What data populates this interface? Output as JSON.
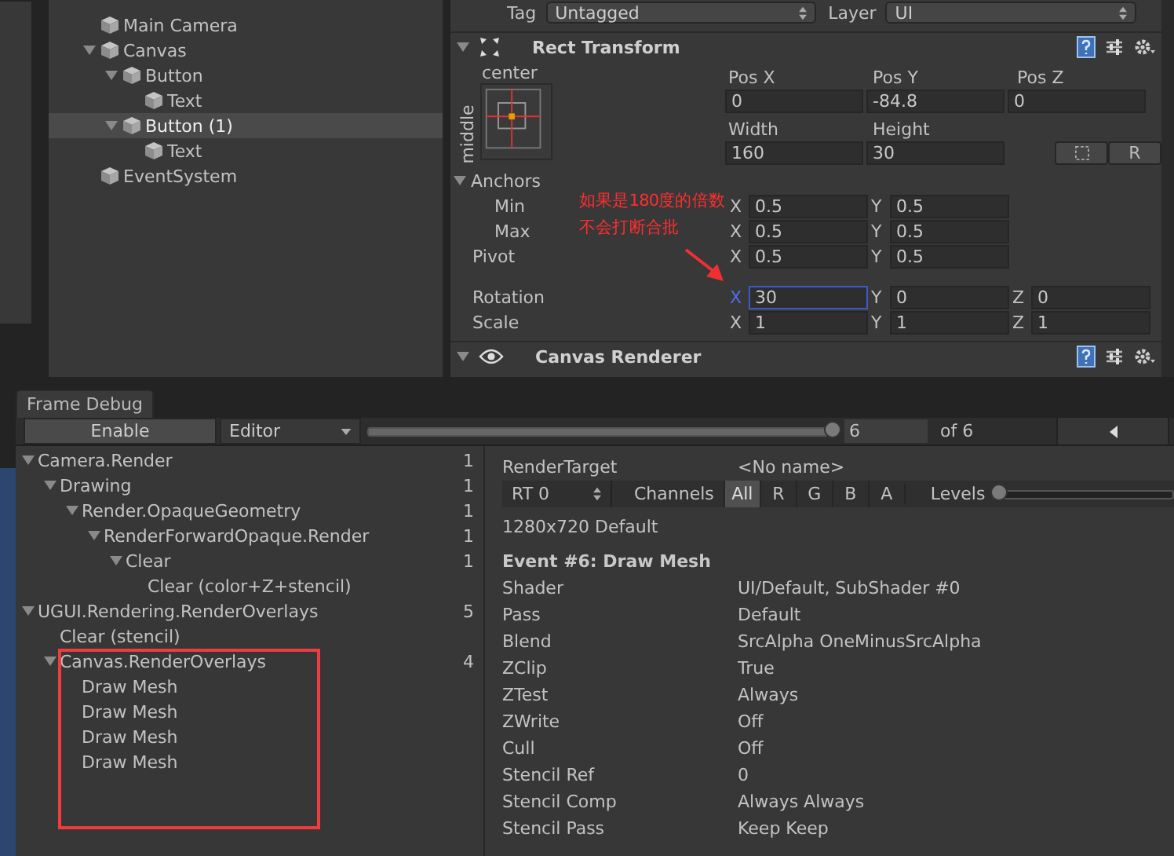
{
  "hierarchy": {
    "items": [
      {
        "label": "Main Camera",
        "selected": false
      },
      {
        "label": "Canvas",
        "selected": false,
        "children": [
          {
            "label": "Button",
            "selected": false,
            "children": [
              {
                "label": "Text",
                "selected": false
              }
            ]
          },
          {
            "label": "Button (1)",
            "selected": true,
            "children": [
              {
                "label": "Text",
                "selected": false
              }
            ]
          }
        ]
      },
      {
        "label": "EventSystem",
        "selected": false
      }
    ]
  },
  "inspector": {
    "tag": {
      "label": "Tag",
      "value": "Untagged"
    },
    "layer": {
      "label": "Layer",
      "value": "UI"
    },
    "rect_transform": {
      "title": "Rect Transform",
      "anchor_horizontal": "center",
      "anchor_vertical": "middle",
      "fields": [
        {
          "label": "Pos X",
          "value": "0"
        },
        {
          "label": "Pos Y",
          "value": "-84.8"
        },
        {
          "label": "Pos Z",
          "value": "0"
        },
        {
          "label": "Width",
          "value": "160"
        },
        {
          "label": "Height",
          "value": "30"
        }
      ],
      "raw_button": "R",
      "rows": [
        {
          "label": "Anchors",
          "children": [
            {
              "label": "Min",
              "values": [
                {
                  "axis": "X",
                  "value": "0.5",
                  "focused": false
                },
                {
                  "axis": "Y",
                  "value": "0.5",
                  "focused": false
                }
              ]
            },
            {
              "label": "Max",
              "values": [
                {
                  "axis": "X",
                  "value": "0.5",
                  "focused": false
                },
                {
                  "axis": "Y",
                  "value": "0.5",
                  "focused": false
                }
              ]
            }
          ]
        },
        {
          "label": "Pivot",
          "values": [
            {
              "axis": "X",
              "value": "0.5",
              "focused": false
            },
            {
              "axis": "Y",
              "value": "0.5",
              "focused": false
            }
          ]
        },
        {
          "label": "Rotation",
          "values": [
            {
              "axis": "X",
              "value": "30",
              "focused": true
            },
            {
              "axis": "Y",
              "value": "0",
              "focused": false
            },
            {
              "axis": "Z",
              "value": "0",
              "focused": false
            }
          ]
        },
        {
          "label": "Scale",
          "values": [
            {
              "axis": "X",
              "value": "1",
              "focused": false
            },
            {
              "axis": "Y",
              "value": "1",
              "focused": false
            },
            {
              "axis": "Z",
              "value": "1",
              "focused": false
            }
          ]
        }
      ]
    },
    "canvas_renderer": {
      "title": "Canvas Renderer"
    }
  },
  "annotation": {
    "lines": [
      "如果是180度的倍数",
      "不会打断合批"
    ]
  },
  "frame_debug": {
    "tab": "Frame Debug",
    "enable_button": "Enable",
    "target": "Editor",
    "event_slider": {
      "level": 1
    },
    "event_number": "6",
    "event_total": "of 6",
    "events": [
      {
        "label": "Camera.Render",
        "count": "1",
        "children": [
          {
            "label": "Drawing",
            "count": "1",
            "children": [
              {
                "label": "Render.OpaqueGeometry",
                "count": "1",
                "children": [
                  {
                    "label": "RenderForwardOpaque.Render",
                    "count": "1",
                    "children": [
                      {
                        "label": "Clear",
                        "count": "1",
                        "children": [
                          {
                            "label": "Clear (color+Z+stencil)"
                          }
                        ]
                      }
                    ]
                  }
                ]
              }
            ]
          }
        ]
      },
      {
        "label": "UGUI.Rendering.RenderOverlays",
        "count": "5",
        "children": [
          {
            "label": "Clear (stencil)"
          },
          {
            "label": "Canvas.RenderOverlays",
            "count": "4",
            "children": [
              {
                "label": "Draw Mesh"
              },
              {
                "label": "Draw Mesh"
              },
              {
                "label": "Draw Mesh"
              },
              {
                "label": "Draw Mesh"
              }
            ]
          }
        ]
      }
    ],
    "render_target": {
      "label": "RenderTarget",
      "value": "<No name>"
    },
    "rt_dropdown": "RT 0",
    "channels_label": "Channels",
    "channels": [
      {
        "label": "All",
        "selected": true
      },
      {
        "label": "R",
        "selected": false
      },
      {
        "label": "G",
        "selected": false
      },
      {
        "label": "B",
        "selected": false
      },
      {
        "label": "A",
        "selected": false
      }
    ],
    "levels_label": "Levels",
    "levels_slider": {
      "level": 0
    },
    "resolution": "1280x720 Default",
    "event_title": "Event #6: Draw Mesh",
    "properties": [
      {
        "label": "Shader",
        "value": "UI/Default, SubShader #0"
      },
      {
        "label": "Pass",
        "value": "Default"
      },
      {
        "label": "Blend",
        "value": "SrcAlpha OneMinusSrcAlpha"
      },
      {
        "label": "ZClip",
        "value": "True"
      },
      {
        "label": "ZTest",
        "value": "Always"
      },
      {
        "label": "ZWrite",
        "value": "Off"
      },
      {
        "label": "Cull",
        "value": "Off"
      },
      {
        "label": "Stencil Ref",
        "value": "0"
      },
      {
        "label": "Stencil Comp",
        "value": "Always Always"
      },
      {
        "label": "Stencil Pass",
        "value": "Keep Keep"
      }
    ]
  }
}
